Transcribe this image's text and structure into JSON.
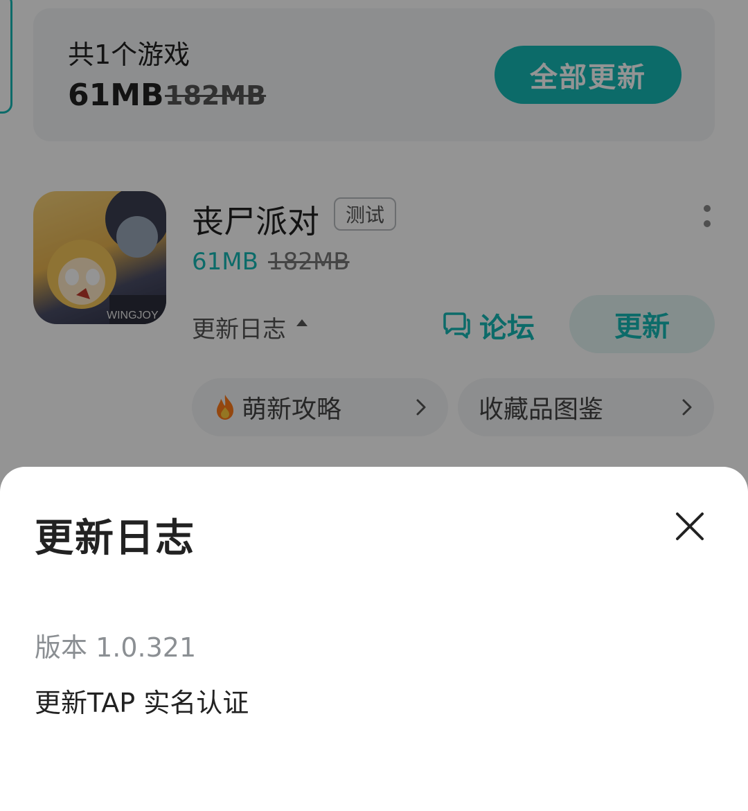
{
  "colors": {
    "accent": "#16b8b6",
    "overlay": "rgba(0,0,0,0.42)"
  },
  "summary": {
    "title": "共1个游戏",
    "size": "61MB",
    "original_size": "182MB",
    "update_all_label": "全部更新"
  },
  "game": {
    "name": "丧尸派对",
    "badge": "测试",
    "size": "61MB",
    "original_size": "182MB",
    "changelog_label": "更新日志",
    "forum_label": "论坛",
    "update_label": "更新",
    "icon_text": "WINGJOY",
    "chips": [
      {
        "label": "萌新攻略",
        "icon": "fire-icon"
      },
      {
        "label": "收藏品图鉴"
      }
    ]
  },
  "sheet": {
    "title": "更新日志",
    "version": "版本 1.0.321",
    "content": "更新TAP 实名认证"
  }
}
